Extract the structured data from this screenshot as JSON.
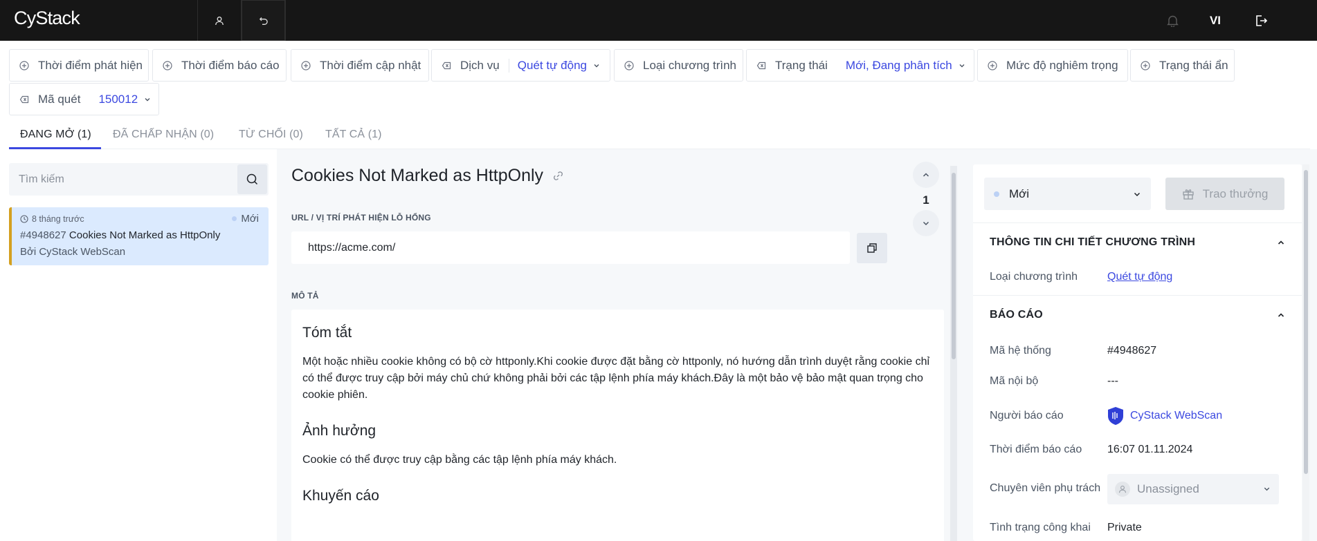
{
  "app": {
    "logo": "CyStack",
    "language": "VI"
  },
  "filters": [
    {
      "label": "Thời điểm phát hiện",
      "value": ""
    },
    {
      "label": "Thời điểm báo cáo",
      "value": ""
    },
    {
      "label": "Thời điểm cập nhật",
      "value": ""
    },
    {
      "label": "Dịch vụ",
      "value": "Quét tự động"
    },
    {
      "label": "Loại chương trình",
      "value": ""
    },
    {
      "label": "Trạng thái",
      "value": "Mới, Đang phân tích"
    },
    {
      "label": "Mức độ nghiêm trọng",
      "value": ""
    },
    {
      "label": "Trạng thái ẩn",
      "value": ""
    },
    {
      "label": "Mã quét",
      "value": "150012"
    }
  ],
  "tabs": [
    {
      "label": "ĐANG MỞ (1)"
    },
    {
      "label": "ĐÃ CHẤP NHẬN (0)"
    },
    {
      "label": "TỪ CHỐI (0)"
    },
    {
      "label": "TẤT CẢ (1)"
    }
  ],
  "search": {
    "placeholder": "Tìm kiếm"
  },
  "list": [
    {
      "time": "8 tháng trước",
      "status": "Mới",
      "id": "#4948627",
      "title": "Cookies Not Marked as HttpOnly",
      "by": "Bởi CyStack WebScan"
    }
  ],
  "detail": {
    "title": "Cookies Not Marked as HttpOnly",
    "nav_count": "1",
    "url_label": "URL / VỊ TRÍ PHÁT HIỆN LỖ HỔNG",
    "url": "https://acme.com/",
    "desc_label": "MÔ TẢ",
    "summary_heading": "Tóm tắt",
    "summary_text": "Một hoặc nhiều cookie không có bộ cờ httponly.Khi cookie được đặt bằng cờ httponly, nó hướng dẫn trình duyệt rằng cookie chỉ có thể được truy cập bởi máy chủ chứ không phải bởi các tập lệnh phía máy khách.Đây là một bảo vệ bảo mật quan trọng cho cookie phiên.",
    "impact_heading": "Ảnh hưởng",
    "impact_text": "Cookie có thể được truy cập bằng các tập lệnh phía máy khách.",
    "recommend_heading": "Khuyến cáo"
  },
  "sidebar": {
    "status": "Mới",
    "reward_button": "Trao thưởng",
    "program_section": "THÔNG TIN CHI TIẾT CHƯƠNG TRÌNH",
    "program_type_label": "Loại chương trình",
    "program_type_value": "Quét tự động",
    "report_section": "BÁO CÁO",
    "system_id_label": "Mã hệ thống",
    "system_id_value": "#4948627",
    "internal_id_label": "Mã nội bộ",
    "internal_id_value": "---",
    "reporter_label": "Người báo cáo",
    "reporter_value": "CyStack WebScan",
    "report_time_label": "Thời điểm báo cáo",
    "report_time_value": "16:07 01.11.2024",
    "assignee_label": "Chuyên viên phụ trách",
    "assignee_value": "Unassigned",
    "visibility_label": "Tình trạng công khai",
    "visibility_value": "Private"
  },
  "colors": {
    "accent": "#3b48e0",
    "topbar": "#161616",
    "selected_item": "#dbeafe",
    "severity_bar": "#d4a020"
  }
}
